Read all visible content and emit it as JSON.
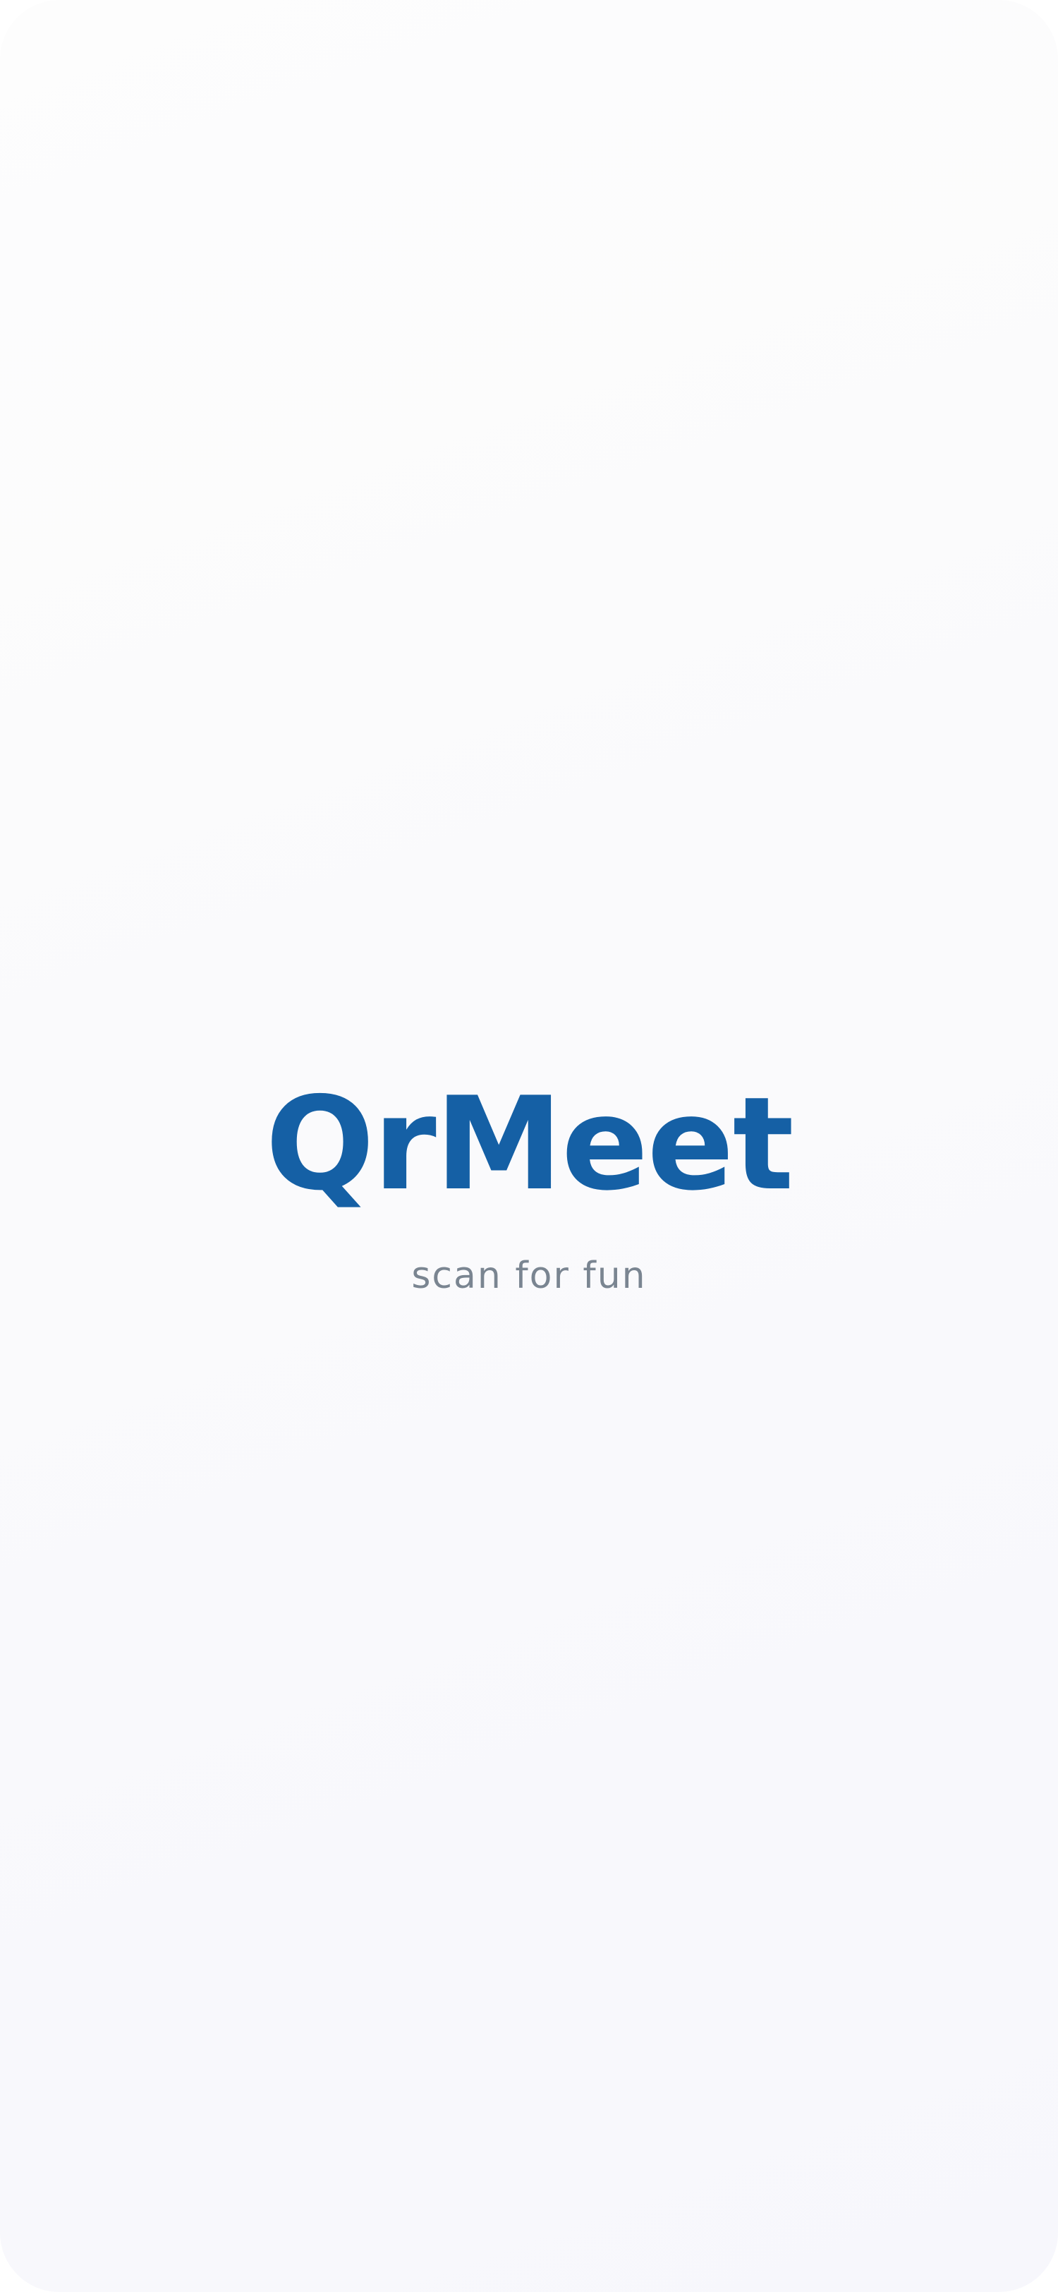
{
  "splash": {
    "title": "QrMeet",
    "tagline": "scan for fun"
  },
  "colors": {
    "brand": "#1560a5",
    "tagline": "#7a8591",
    "background": "#fafafc"
  }
}
